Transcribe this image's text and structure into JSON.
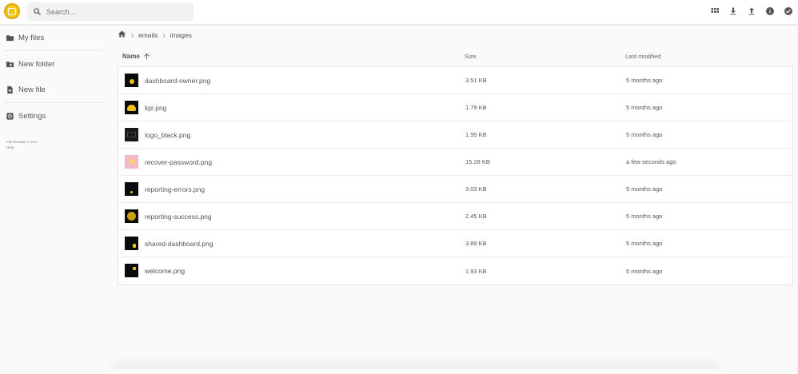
{
  "header": {
    "search_placeholder": "Search...",
    "actions": [
      {
        "name": "grid-view-icon"
      },
      {
        "name": "download-icon"
      },
      {
        "name": "upload-icon"
      },
      {
        "name": "info-icon"
      },
      {
        "name": "check-circle-icon"
      }
    ]
  },
  "sidebar": {
    "items": [
      {
        "label": "My files",
        "icon": "folder-icon"
      },
      {
        "label": "New folder",
        "icon": "new-folder-icon"
      },
      {
        "label": "New file",
        "icon": "new-file-icon"
      },
      {
        "label": "Settings",
        "icon": "settings-icon"
      }
    ],
    "version": "File Browser 2.18.0",
    "help": "Help"
  },
  "breadcrumb": [
    "emails",
    "images"
  ],
  "table": {
    "headers": {
      "name": "Name",
      "size": "Size",
      "modified": "Last modified"
    },
    "rows": [
      {
        "name": "dashboard-owner.png",
        "size": "3.51 KB",
        "modified": "5 months ago"
      },
      {
        "name": "kpi.png",
        "size": "1.79 KB",
        "modified": "5 months ago"
      },
      {
        "name": "logo_black.png",
        "size": "1.95 KB",
        "modified": "5 months ago"
      },
      {
        "name": "recover-password.png",
        "size": "15.28 KB",
        "modified": "a few seconds ago"
      },
      {
        "name": "reporting-errors.png",
        "size": "3.03 KB",
        "modified": "5 months ago"
      },
      {
        "name": "reporting-success.png",
        "size": "2.45 KB",
        "modified": "5 months ago"
      },
      {
        "name": "shared-dashboard.png",
        "size": "3.89 KB",
        "modified": "5 months ago"
      },
      {
        "name": "welcome.png",
        "size": "1.93 KB",
        "modified": "5 months ago"
      }
    ]
  },
  "colors": {
    "accent": "#f0c014",
    "icon": "#555555"
  }
}
